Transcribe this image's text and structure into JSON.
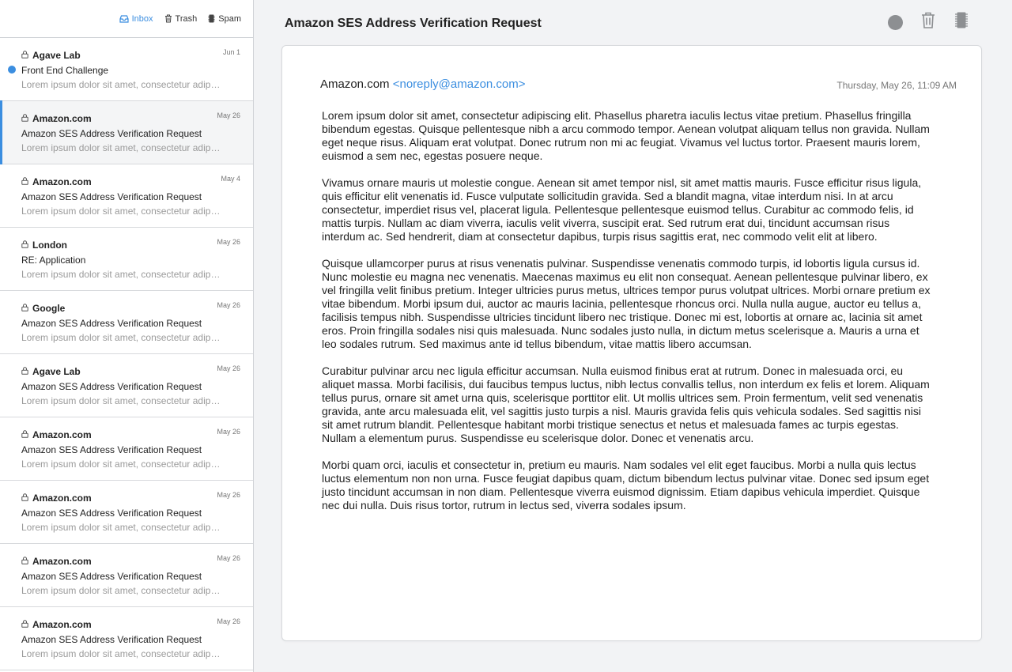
{
  "folders": [
    {
      "label": "Inbox",
      "icon": "inbox-icon",
      "active": true
    },
    {
      "label": "Trash",
      "icon": "trash-icon",
      "active": false
    },
    {
      "label": "Spam",
      "icon": "spam-icon",
      "active": false
    }
  ],
  "mails": [
    {
      "sender": "Agave Lab",
      "date": "Jun 1",
      "subject": "Front End Challenge",
      "preview": "Lorem ipsum dolor sit amet, consectetur adipiscing elit.",
      "unread": true,
      "selected": false
    },
    {
      "sender": "Amazon.com",
      "date": "May 26",
      "subject": "Amazon SES Address Verification Request",
      "preview": "Lorem ipsum dolor sit amet, consectetur adipiscing elit.",
      "unread": false,
      "selected": true
    },
    {
      "sender": "Amazon.com",
      "date": "May 4",
      "subject": "Amazon SES Address Verification Request",
      "preview": "Lorem ipsum dolor sit amet, consectetur adipiscing elit.",
      "unread": false,
      "selected": false
    },
    {
      "sender": "London",
      "date": "May 26",
      "subject": "RE: Application",
      "preview": "Lorem ipsum dolor sit amet, consectetur adipiscing elit.",
      "unread": false,
      "selected": false
    },
    {
      "sender": "Google",
      "date": "May 26",
      "subject": "Amazon SES Address Verification Request",
      "preview": "Lorem ipsum dolor sit amet, consectetur adipiscing elit.",
      "unread": false,
      "selected": false
    },
    {
      "sender": "Agave Lab",
      "date": "May 26",
      "subject": "Amazon SES Address Verification Request",
      "preview": "Lorem ipsum dolor sit amet, consectetur adipiscing elit.",
      "unread": false,
      "selected": false
    },
    {
      "sender": "Amazon.com",
      "date": "May 26",
      "subject": "Amazon SES Address Verification Request",
      "preview": "Lorem ipsum dolor sit amet, consectetur adipiscing elit.",
      "unread": false,
      "selected": false
    },
    {
      "sender": "Amazon.com",
      "date": "May 26",
      "subject": "Amazon SES Address Verification Request",
      "preview": "Lorem ipsum dolor sit amet, consectetur adipiscing elit.",
      "unread": false,
      "selected": false
    },
    {
      "sender": "Amazon.com",
      "date": "May 26",
      "subject": "Amazon SES Address Verification Request",
      "preview": "Lorem ipsum dolor sit amet, consectetur adipiscing elit.",
      "unread": false,
      "selected": false
    },
    {
      "sender": "Amazon.com",
      "date": "May 26",
      "subject": "Amazon SES Address Verification Request",
      "preview": "Lorem ipsum dolor sit amet, consectetur adipiscing elit.",
      "unread": false,
      "selected": false
    }
  ],
  "message": {
    "title": "Amazon SES Address Verification Request",
    "from_name": "Amazon.com",
    "from_address": "<noreply@amazon.com>",
    "date": "Thursday, May 26, 11:09 AM",
    "paragraphs": [
      "Lorem ipsum dolor sit amet, consectetur adipiscing elit. Phasellus pharetra iaculis lectus vitae pretium. Phasellus fringilla bibendum egestas. Quisque pellentesque nibh a arcu commodo tempor. Aenean volutpat aliquam tellus non gravida. Nullam eget neque risus. Aliquam erat volutpat. Donec rutrum non mi ac feugiat. Vivamus vel luctus tortor. Praesent mauris lorem, euismod a sem nec, egestas posuere neque.",
      "Vivamus ornare mauris ut molestie congue. Aenean sit amet tempor nisl, sit amet mattis mauris. Fusce efficitur risus ligula, quis efficitur elit venenatis id. Fusce vulputate sollicitudin gravida. Sed a blandit magna, vitae interdum nisi. In at arcu consectetur, imperdiet risus vel, placerat ligula. Pellentesque pellentesque euismod tellus. Curabitur ac commodo felis, id mattis turpis. Nullam ac diam viverra, iaculis velit viverra, suscipit erat. Sed rutrum erat dui, tincidunt accumsan risus interdum ac. Sed hendrerit, diam at consectetur dapibus, turpis risus sagittis erat, nec commodo velit elit at libero.",
      "Quisque ullamcorper purus at risus venenatis pulvinar. Suspendisse venenatis commodo turpis, id lobortis ligula cursus id. Nunc molestie eu magna nec venenatis. Maecenas maximus eu elit non consequat. Aenean pellentesque pulvinar libero, ex vel fringilla velit finibus pretium. Integer ultricies purus metus, ultrices tempor purus volutpat ultrices. Morbi ornare pretium ex vitae bibendum. Morbi ipsum dui, auctor ac mauris lacinia, pellentesque rhoncus orci. Nulla nulla augue, auctor eu tellus a, facilisis tempus nibh. Suspendisse ultricies tincidunt libero nec tristique. Donec mi est, lobortis at ornare ac, lacinia sit amet eros. Proin fringilla sodales nisi quis malesuada. Nunc sodales justo nulla, in dictum metus scelerisque a. Mauris a urna et leo sodales rutrum. Sed maximus ante id tellus bibendum, vitae mattis libero accumsan.",
      "Curabitur pulvinar arcu nec ligula efficitur accumsan. Nulla euismod finibus erat at rutrum. Donec in malesuada orci, eu aliquet massa. Morbi facilisis, dui faucibus tempus luctus, nibh lectus convallis tellus, non interdum ex felis et lorem. Aliquam tellus purus, ornare sit amet urna quis, scelerisque porttitor elit. Ut mollis ultrices sem. Proin fermentum, velit sed venenatis gravida, ante arcu malesuada elit, vel sagittis justo turpis a nisl. Mauris gravida felis quis vehicula sodales. Sed sagittis nisi sit amet rutrum blandit. Pellentesque habitant morbi tristique senectus et netus et malesuada fames ac turpis egestas. Nullam a elementum purus. Suspendisse eu scelerisque dolor. Donec et venenatis arcu.",
      "Morbi quam orci, iaculis et consectetur in, pretium eu mauris. Nam sodales vel elit eget faucibus. Morbi a nulla quis lectus luctus elementum non non urna. Fusce feugiat dapibus quam, dictum bibendum lectus pulvinar vitae. Donec sed ipsum eget justo tincidunt accumsan in non diam. Pellentesque viverra euismod dignissim. Etiam dapibus vehicula imperdiet. Quisque nec dui nulla. Duis risus tortor, rutrum in lectus sed, viverra sodales ipsum."
    ]
  },
  "toolbar": {
    "buttons": [
      "mark-unread-icon",
      "trash-icon",
      "spam-icon"
    ]
  },
  "colors": {
    "accent": "#3b8ee0",
    "icon_gray": "#8d8f92"
  }
}
